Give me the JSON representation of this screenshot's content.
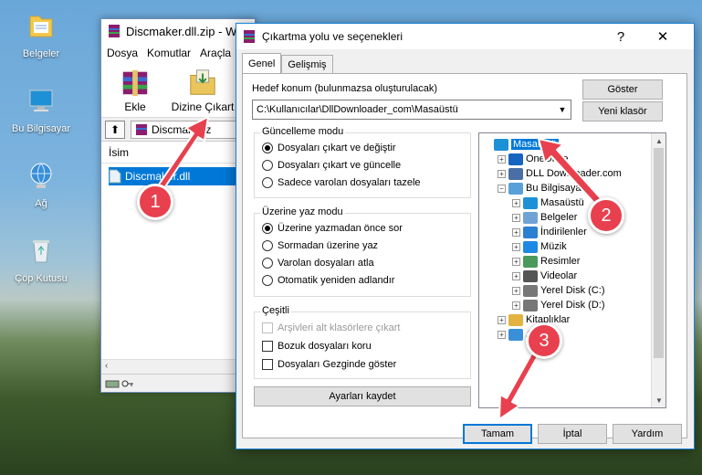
{
  "desktop": {
    "icons": [
      {
        "label": "Belgeler",
        "icon": "folder-documents-icon"
      },
      {
        "label": "Bu Bilgisayar",
        "icon": "computer-icon"
      },
      {
        "label": "Ağ",
        "icon": "network-icon"
      },
      {
        "label": "Çöp Kutusu",
        "icon": "recycle-bin-icon"
      }
    ]
  },
  "winrar": {
    "title": "Discmaker.dll.zip - W",
    "menu": [
      "Dosya",
      "Komutlar",
      "Araçla"
    ],
    "toolbar": {
      "add": "Ekle",
      "extract_to": "Dizine Çıkart"
    },
    "address": "Discmaker.z",
    "column_name": "İsim",
    "file": "Discmaker.dll"
  },
  "dialog": {
    "title": "Çıkartma yolu ve seçenekleri",
    "help_glyph": "?",
    "close_glyph": "✕",
    "tabs": [
      "Genel",
      "Gelişmiş"
    ],
    "destination_label": "Hedef konum (bulunmazsa oluşturulacak)",
    "destination_value": "C:\\Kullanıcılar\\DllDownloader_com\\Masaüstü",
    "show_button": "Göster",
    "new_folder_button": "Yeni klasör",
    "update_mode": {
      "title": "Güncelleme modu",
      "options": [
        "Dosyaları çıkart ve değiştir",
        "Dosyaları çıkart ve güncelle",
        "Sadece varolan dosyaları tazele"
      ],
      "selected": 0
    },
    "overwrite_mode": {
      "title": "Üzerine yaz modu",
      "options": [
        "Üzerine yazmadan önce sor",
        "Sormadan üzerine yaz",
        "Varolan dosyaları atla",
        "Otomatik yeniden adlandır"
      ],
      "selected": 0
    },
    "misc": {
      "title": "Çeşitli",
      "options": [
        {
          "label": "Arşivleri alt klasörlere çıkart",
          "checked": false,
          "disabled": true
        },
        {
          "label": "Bozuk dosyaları koru",
          "checked": false,
          "disabled": false
        },
        {
          "label": "Dosyaları Gezginde göster",
          "checked": false,
          "disabled": false
        }
      ]
    },
    "save_settings_button": "Ayarları kaydet",
    "tree": [
      {
        "label": "Masaüstü",
        "level": 0,
        "expander": "",
        "icon": "desktop-folder-icon",
        "selected": true
      },
      {
        "label": "OneDrive",
        "level": 1,
        "expander": "+",
        "icon": "cloud-icon",
        "selected": false
      },
      {
        "label": "DLL Downloader.com",
        "level": 1,
        "expander": "+",
        "icon": "user-icon",
        "selected": false
      },
      {
        "label": "Bu Bilgisayar",
        "level": 1,
        "expander": "−",
        "icon": "computer-icon",
        "selected": false
      },
      {
        "label": "Masaüstü",
        "level": 2,
        "expander": "+",
        "icon": "desktop-folder-icon",
        "selected": false
      },
      {
        "label": "Belgeler",
        "level": 2,
        "expander": "+",
        "icon": "documents-icon",
        "selected": false
      },
      {
        "label": "İndirilenler",
        "level": 2,
        "expander": "+",
        "icon": "downloads-icon",
        "selected": false
      },
      {
        "label": "Müzik",
        "level": 2,
        "expander": "+",
        "icon": "music-icon",
        "selected": false
      },
      {
        "label": "Resimler",
        "level": 2,
        "expander": "+",
        "icon": "pictures-icon",
        "selected": false
      },
      {
        "label": "Videolar",
        "level": 2,
        "expander": "+",
        "icon": "videos-icon",
        "selected": false
      },
      {
        "label": "Yerel Disk (C:)",
        "level": 2,
        "expander": "+",
        "icon": "drive-icon",
        "selected": false
      },
      {
        "label": "Yerel Disk (D:)",
        "level": 2,
        "expander": "+",
        "icon": "drive-icon",
        "selected": false
      },
      {
        "label": "Kitaplıklar",
        "level": 1,
        "expander": "+",
        "icon": "library-icon",
        "selected": false
      },
      {
        "label": "Ağ",
        "level": 1,
        "expander": "+",
        "icon": "network-icon",
        "selected": false
      }
    ],
    "ok_button": "Tamam",
    "cancel_button": "İptal",
    "help_button": "Yardım"
  },
  "annotations": {
    "markers": [
      "1",
      "2",
      "3"
    ],
    "color": "#e8404e"
  }
}
